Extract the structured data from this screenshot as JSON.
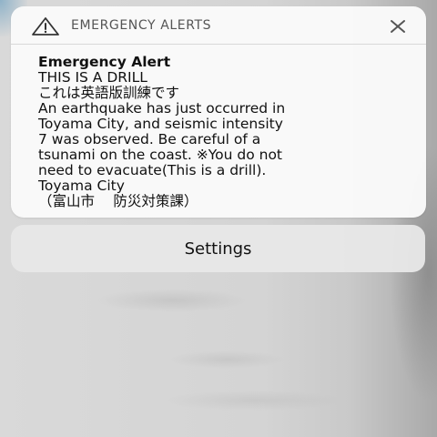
{
  "header": {
    "app_name": "EMERGENCY ALERTS",
    "icon": "warning-triangle-icon",
    "close_icon": "close-icon"
  },
  "alert": {
    "title": "Emergency Alert",
    "lines": [
      "THIS IS A DRILL",
      "これは英語版訓練です",
      "An earthquake has just occurred in",
      "Toyama City, and seismic intensity",
      "7 was observed. Be careful of a",
      "tsunami on the coast. ※You do not",
      "need to evacuate(This is a drill).",
      "Toyama City",
      "（富山市　 防災対策課）"
    ]
  },
  "settings_button": {
    "label": "Settings"
  }
}
